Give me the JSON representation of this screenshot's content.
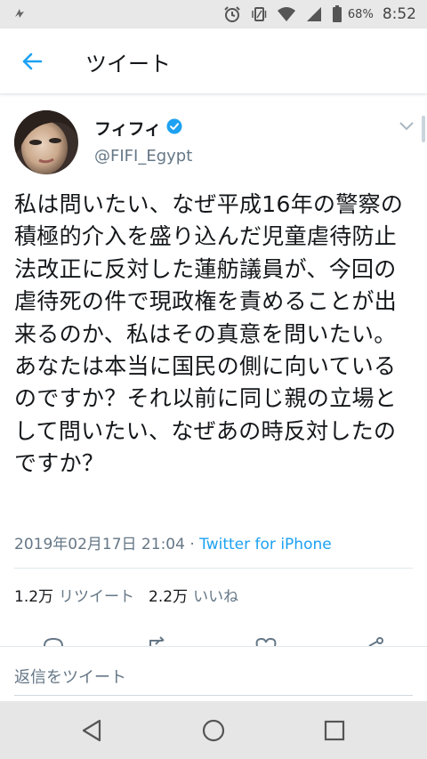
{
  "status_bar": {
    "battery_percent": "68%",
    "time": "8:52",
    "icons": [
      "notification-icon",
      "alarm-icon",
      "vibrate-icon",
      "wifi-icon",
      "signal-icon",
      "battery-icon"
    ]
  },
  "header": {
    "title": "ツイート",
    "back_icon": "back-arrow-icon"
  },
  "tweet": {
    "display_name": "フィフィ",
    "verified_icon": "verified-badge-icon",
    "handle": "@FIFI_Egypt",
    "menu_icon": "chevron-down-icon",
    "text": "私は問いたい、なぜ平成16年の警察の積極的介入を盛り込んだ児童虐待防止法改正に反対した蓮舫議員が、今回の虐待死の件で現政権を責めることが出来るのか、私はその真意を問いたい。あなたは本当に国民の側に向いているのですか？それ以前に同じ親の立場として問いたい、なぜあの時反対したのですか？",
    "timestamp": "2019年02月17日 21:04",
    "separator": " · ",
    "source": "Twitter for iPhone",
    "retweets_count": "1.2万",
    "retweets_label": "リツイート",
    "likes_count": "2.2万",
    "likes_label": "いいね"
  },
  "reply": {
    "placeholder": "返信をツイート"
  },
  "nav_bar": {
    "buttons": [
      "back-triangle-icon",
      "home-circle-icon",
      "recents-square-icon"
    ]
  },
  "colors": {
    "accent": "#1da1f2",
    "secondary_text": "#657786",
    "primary_text": "#14171a",
    "status_bar_bg": "#e8e8e8",
    "nav_bar_bg": "#e6e6e6"
  }
}
